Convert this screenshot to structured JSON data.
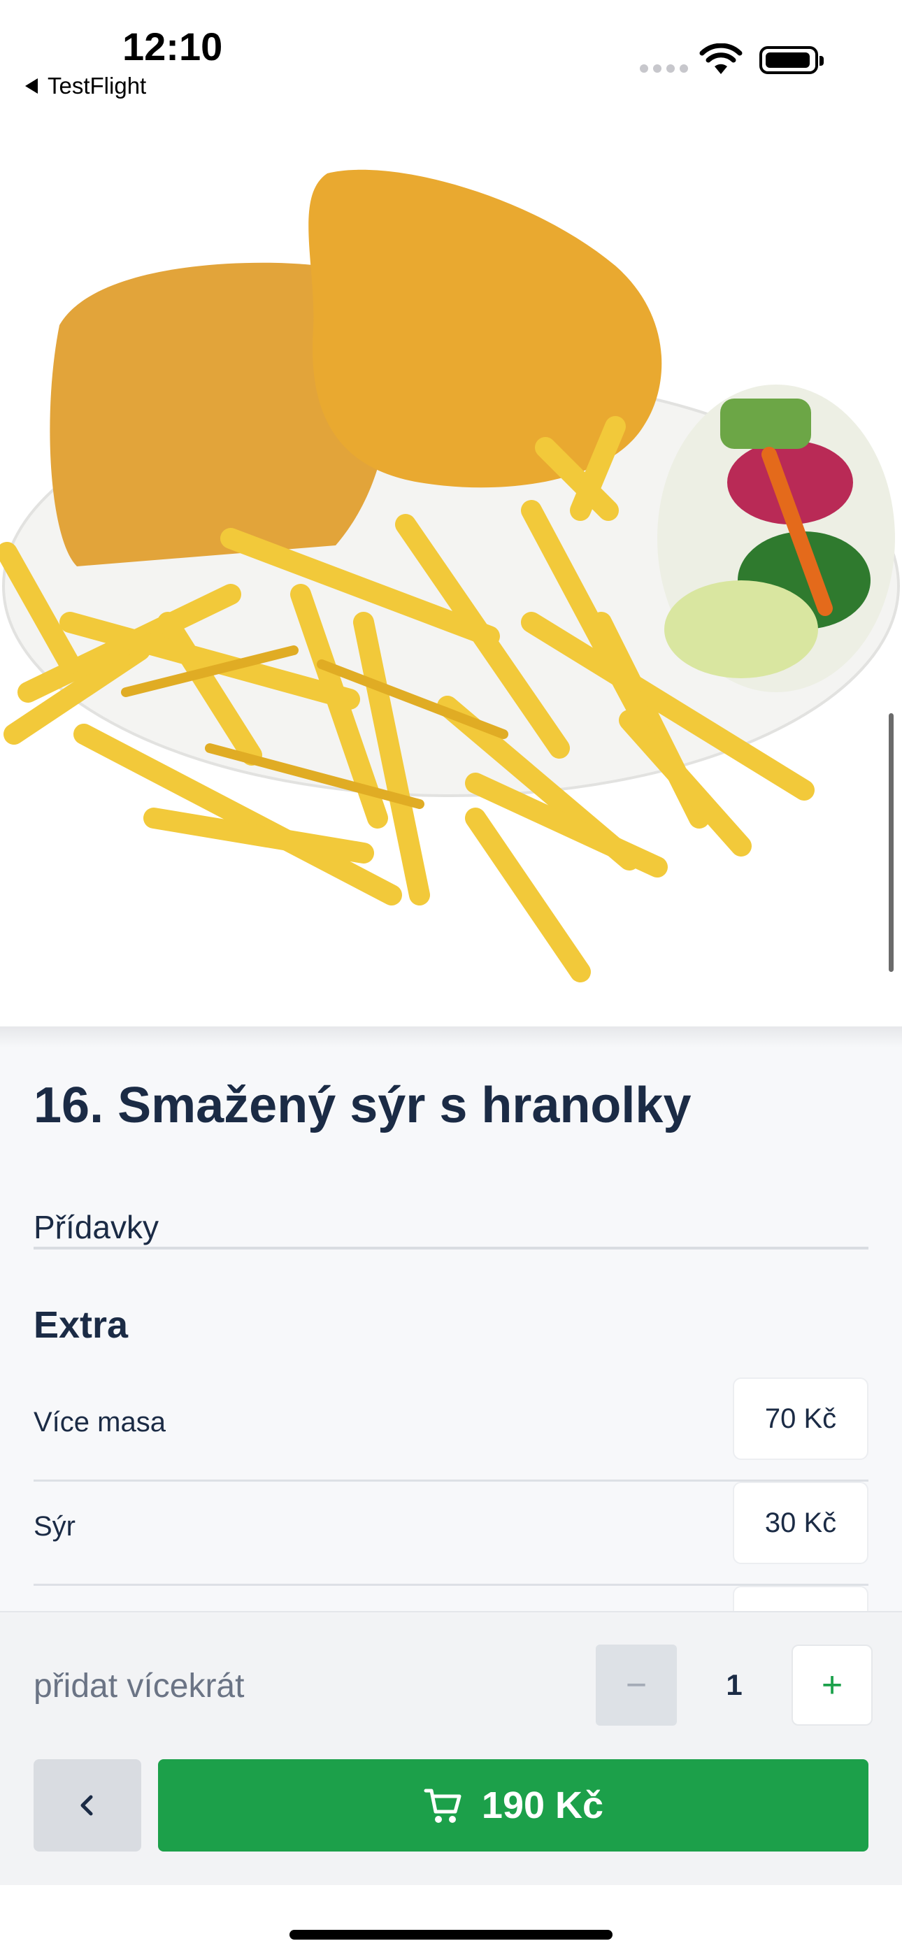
{
  "status_bar": {
    "time": "12:10",
    "back_app": "TestFlight"
  },
  "product": {
    "title": "16. Smažený sýr s hranolky",
    "addons_label": "Přídavky",
    "extra_heading": "Extra",
    "extras": [
      {
        "name": "Více masa",
        "price": "70 Kč"
      },
      {
        "name": "Sýr",
        "price": "30 Kč"
      }
    ]
  },
  "quantity": {
    "label": "přidat vícekrát",
    "value": "1",
    "minus": "−",
    "plus": "+"
  },
  "cart": {
    "total": "190 Kč"
  },
  "colors": {
    "accent": "#1CA04A",
    "text": "#1B2B45",
    "background": "#F7F8FA"
  },
  "icons": [
    "back-app-icon",
    "signal-icon",
    "wifi-icon",
    "battery-icon",
    "chevron-left-icon",
    "cart-icon"
  ]
}
